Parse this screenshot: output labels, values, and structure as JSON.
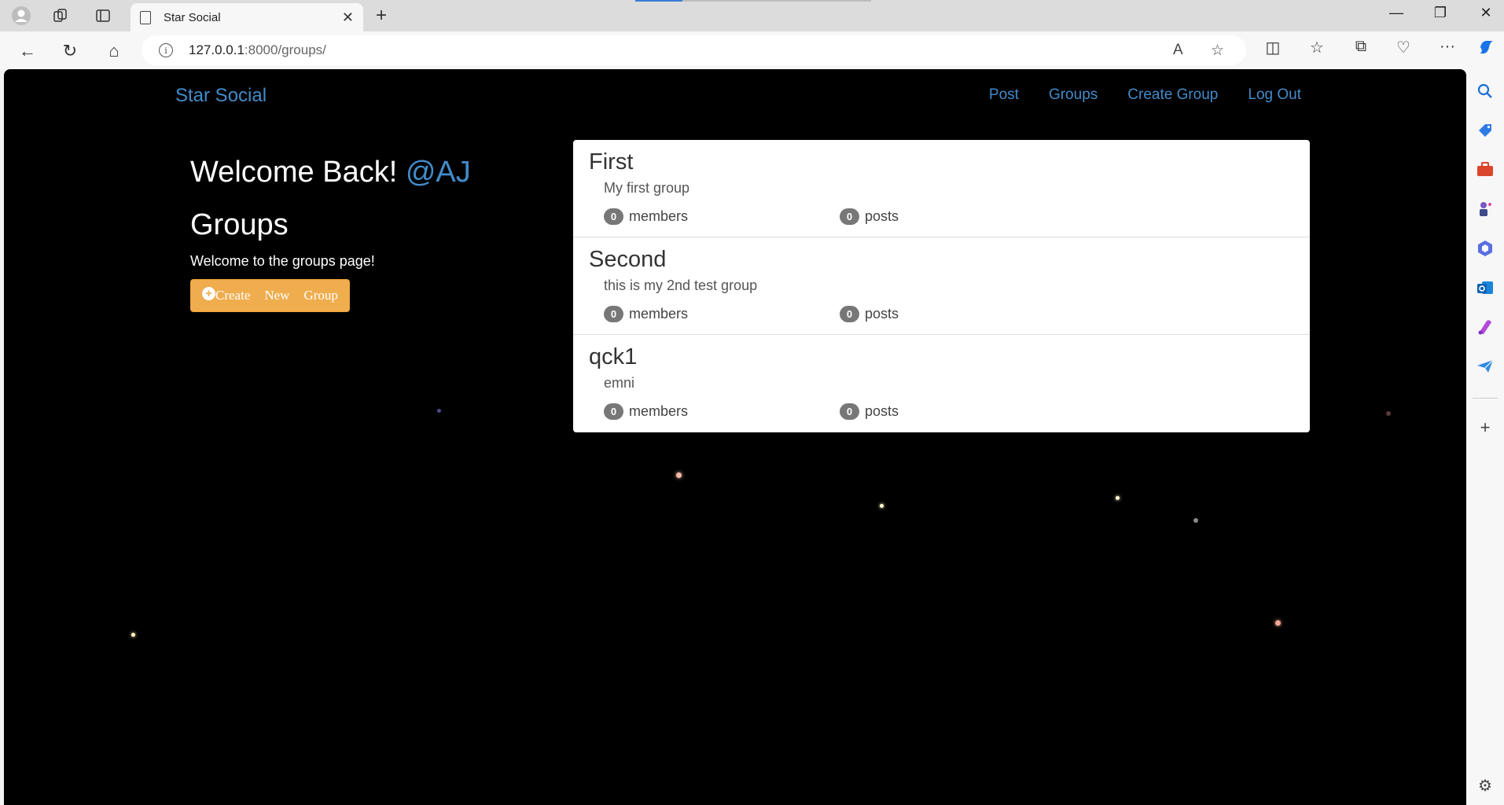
{
  "browser": {
    "tab_title": "Star Social",
    "url_host": "127.0.0.1",
    "url_path": ":8000/groups/"
  },
  "site": {
    "brand": "Star Social",
    "nav": [
      {
        "label": "Post"
      },
      {
        "label": "Groups"
      },
      {
        "label": "Create Group"
      },
      {
        "label": "Log Out"
      }
    ]
  },
  "sidebar": {
    "welcome_prefix": "Welcome Back!",
    "username": "@AJ",
    "groups_title": "Groups",
    "groups_desc": "Welcome to the groups page!",
    "create_button": {
      "word1": "Create",
      "word2": "New",
      "word3": "Group"
    }
  },
  "groups": [
    {
      "name": "First",
      "description": "My first group",
      "members": "0",
      "members_label": "members",
      "posts": "0",
      "posts_label": "posts"
    },
    {
      "name": "Second",
      "description": "this is my 2nd test group",
      "members": "0",
      "members_label": "members",
      "posts": "0",
      "posts_label": "posts"
    },
    {
      "name": "qck1",
      "description": "emni",
      "members": "0",
      "members_label": "members",
      "posts": "0",
      "posts_label": "posts"
    }
  ],
  "colors": {
    "link": "#428bca",
    "warning_button": "#f0ad4e",
    "badge": "#777777",
    "background": "#000000"
  }
}
